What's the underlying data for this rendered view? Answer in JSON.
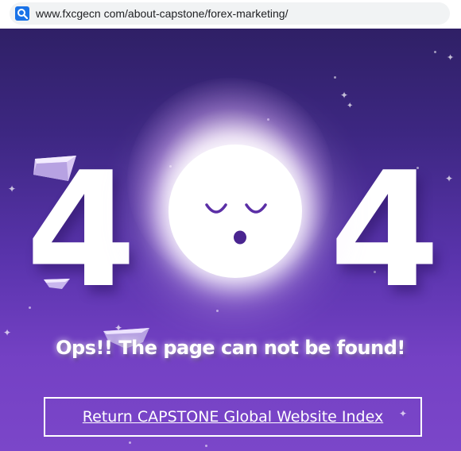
{
  "browser": {
    "url": "www.fxcgecn com/about-capstone/forex-marketing/",
    "url_icon": "search-icon"
  },
  "error_page": {
    "digit_left": "4",
    "digit_right": "4",
    "center_graphic": "sleeping-moon-icon",
    "message": "Ops!! The page can not be found!",
    "return_link": "Return CAPSTONE Global Website Index"
  },
  "colors": {
    "background_top": "#2f2066",
    "background_bottom": "#7b46c9",
    "moon_face": "#5b2fa6",
    "text": "#ffffff"
  }
}
